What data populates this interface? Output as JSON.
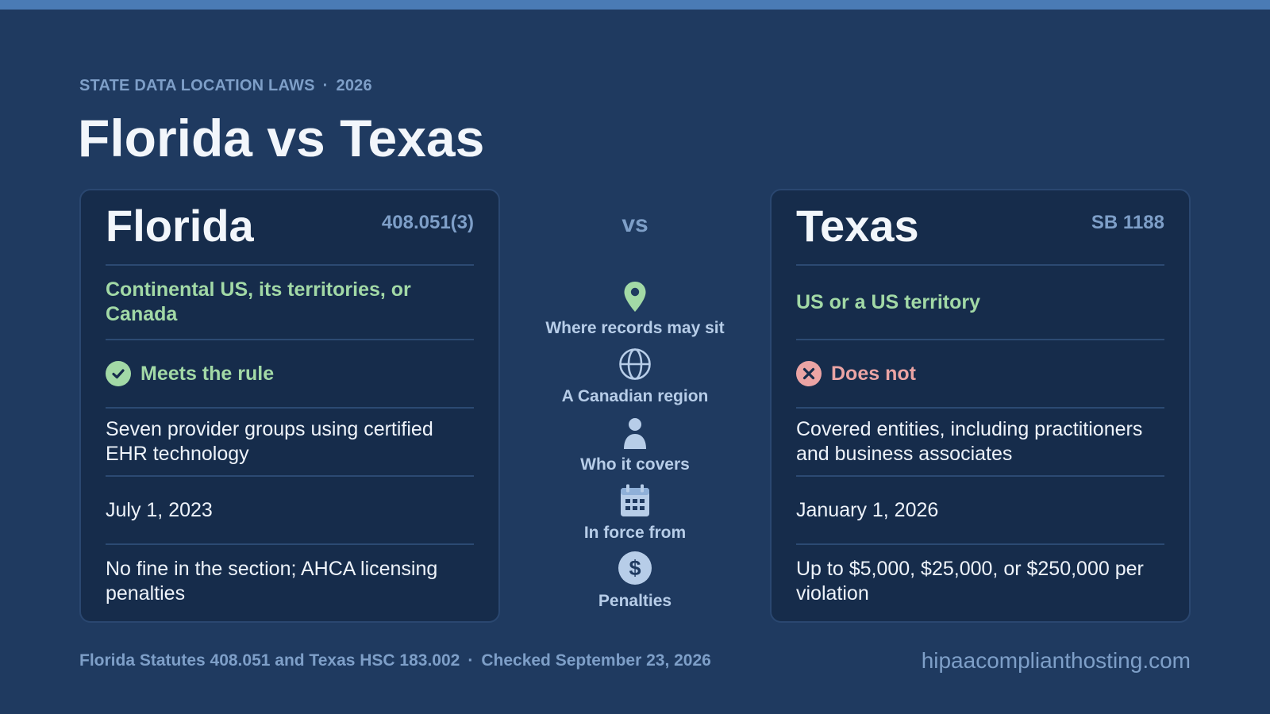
{
  "header": {
    "eyebrow_topic": "STATE DATA LOCATION LAWS",
    "eyebrow_separator": "·",
    "eyebrow_year": "2026",
    "title": "Florida vs Texas"
  },
  "vs_label": "vs",
  "criteria": [
    {
      "label": "Where records may sit",
      "icon": "map-pin-icon"
    },
    {
      "label": "A Canadian region",
      "icon": "globe-icon"
    },
    {
      "label": "Who it covers",
      "icon": "person-icon"
    },
    {
      "label": "In force from",
      "icon": "calendar-icon"
    },
    {
      "label": "Penalties",
      "icon": "dollar-icon"
    }
  ],
  "florida": {
    "name": "Florida",
    "statute": "408.051(3)",
    "where": "Continental US, its territories, or Canada",
    "canadian_status": "Meets the rule",
    "canadian_status_icon": "check-circle-icon",
    "covers": "Seven provider groups using certified EHR technology",
    "in_force": "July 1, 2023",
    "penalties": "No fine in the section; AHCA licensing penalties"
  },
  "texas": {
    "name": "Texas",
    "statute": "SB 1188",
    "where": "US or a US territory",
    "canadian_status": "Does not",
    "canadian_status_icon": "x-circle-icon",
    "covers": "Covered entities, including practitioners and business associates",
    "in_force": "January 1, 2026",
    "penalties": "Up to $5,000, $25,000, or $250,000 per violation"
  },
  "footer": {
    "sources": "Florida Statutes 408.051 and Texas HSC 183.002",
    "separator": "·",
    "checked": "Checked September 23, 2026",
    "site": "hipaacomplianthosting.com"
  },
  "colors": {
    "background": "#1f3a60",
    "card": "#162c4b",
    "accent_bar": "#4a7bb5",
    "meets_green": "#a2d9a6",
    "fails_red": "#eba4a4",
    "muted_blue": "#7e9fc8"
  }
}
